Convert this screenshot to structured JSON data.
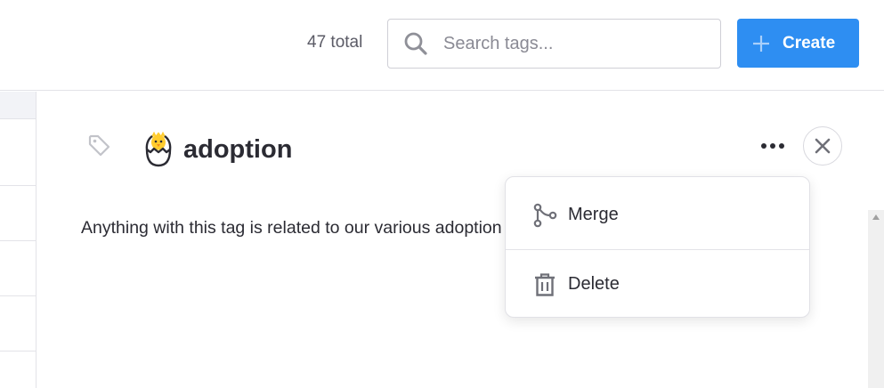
{
  "header": {
    "total_label": "47 total",
    "search_placeholder": "Search tags...",
    "search_value": "",
    "create_label": "Create"
  },
  "detail": {
    "emoji_icon": "hatching-chick-icon",
    "title": "adoption",
    "description": "Anything with this tag is related to our various adoption"
  },
  "menu": {
    "items": [
      {
        "label": "Merge",
        "icon": "merge-icon"
      },
      {
        "label": "Delete",
        "icon": "trash-icon"
      }
    ]
  },
  "colors": {
    "accent": "#2e8ef2",
    "text": "#2b2b33",
    "muted": "#8a8a94",
    "border": "#e3e3e8"
  }
}
